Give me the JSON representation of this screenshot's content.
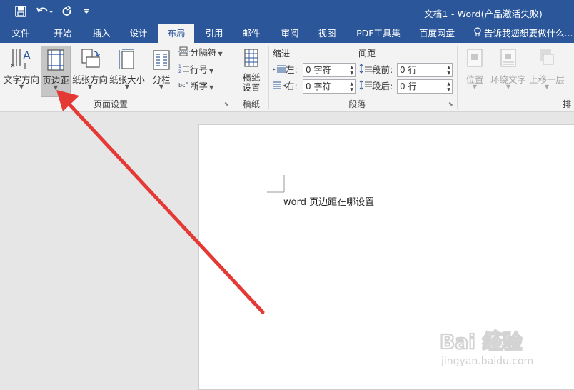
{
  "titlebar": {
    "title": "文档1 - Word(产品激活失败)",
    "quick_access": [
      "save-icon",
      "undo-icon",
      "redo-icon",
      "customize-icon"
    ]
  },
  "tabs": [
    "文件",
    "开始",
    "插入",
    "设计",
    "布局",
    "引用",
    "邮件",
    "审阅",
    "视图",
    "PDF工具集",
    "百度网盘"
  ],
  "active_tab": "布局",
  "tellme": "告诉我您想要做什么...",
  "ribbon": {
    "page_setup": {
      "label": "页面设置",
      "text_direction": "文字方向",
      "margins": "页边距",
      "orientation": "纸张方向",
      "size": "纸张大小",
      "columns": "分栏",
      "breaks": "分隔符",
      "line_numbers": "行号",
      "hyphenation": "断字"
    },
    "draft": {
      "label": "稿纸",
      "settings_line1": "稿纸",
      "settings_line2": "设置"
    },
    "paragraph": {
      "label": "段落",
      "indent_title": "缩进",
      "spacing_title": "间距",
      "left_label": "左:",
      "right_label": "右:",
      "before_label": "段前:",
      "after_label": "段后:",
      "left_value": "0 字符",
      "right_value": "0 字符",
      "before_value": "0 行",
      "after_value": "0 行"
    },
    "arrange": {
      "position": "位置",
      "wrap_text": "环绕文字",
      "bring_forward": "上移一层",
      "label_partial": "排"
    }
  },
  "document": {
    "text": "word 页边距在哪设置"
  },
  "watermark": {
    "brand": "Bai 经验",
    "url": "jingyan.baidu.com"
  },
  "colors": {
    "word_blue": "#2b579a",
    "ribbon_bg": "#f3f3f3",
    "arrow_red": "#e53935"
  }
}
